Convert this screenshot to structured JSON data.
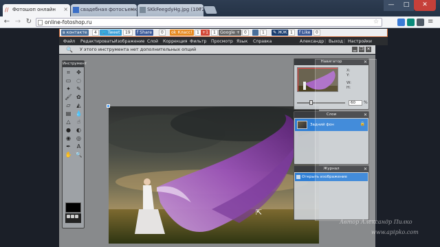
{
  "browser": {
    "tabs": [
      {
        "title": "Фотошоп онлайн",
        "favicon_color": "#c0392b",
        "active": true
      },
      {
        "title": "свадебная фотосъемка 2...",
        "favicon_color": "#3b6fc7",
        "active": false
      },
      {
        "title": "SKkFeegdyHg.jpg (1072×7...",
        "favicon_color": "#7a8a99",
        "active": false
      }
    ],
    "url": "online-fotoshop.ru",
    "controls": {
      "minimize": "—",
      "maximize": "□",
      "close": "✕"
    }
  },
  "social": {
    "items": [
      {
        "label": "контакте",
        "count": "4",
        "color": "#4a6f9a"
      },
      {
        "label": "Tweet",
        "count": "19",
        "color": "#3aa0d8"
      },
      {
        "label": "Share",
        "count": "0",
        "color": "#3b5998"
      },
      {
        "label": "Класс!",
        "count": "1",
        "color": "#e78b22"
      },
      {
        "label": "+1",
        "count": "1",
        "color": "#d34836"
      },
      {
        "label": "Google +",
        "count": "0",
        "color": "#666666"
      },
      {
        "label": "",
        "count": "1",
        "color": "#4a6f9a"
      },
      {
        "label": "ЖЖ",
        "count": "1",
        "color": "#1a3d6f"
      },
      {
        "label": "Like",
        "count": "0",
        "color": "#3b5998"
      }
    ]
  },
  "menu": {
    "items": [
      "Файл",
      "Редактировать",
      "Изображение",
      "Слой",
      "Коррекция",
      "Фильтр",
      "Просмотр",
      "Язык",
      "Справка"
    ],
    "user": "Александр",
    "logout": "Выход",
    "settings": "Настройки"
  },
  "optionsbar": {
    "text": "У этого инструмента нет дополнительных опций"
  },
  "tools": {
    "title": "Инструмент",
    "icons": [
      "crop-icon",
      "move-icon",
      "marquee-icon",
      "lasso-icon",
      "wand-icon",
      "pencil-icon",
      "brush-icon",
      "clone-icon",
      "eraser-icon",
      "bucket-icon",
      "gradient-icon",
      "blur-icon",
      "sharpen-icon",
      "smudge-icon",
      "dodge-icon",
      "burn-icon",
      "sponge-icon",
      "redeye-icon",
      "eyedropper-icon",
      "text-icon",
      "hand-icon",
      "zoom-icon"
    ],
    "glyphs": [
      "⌗",
      "✥",
      "▭",
      "◌",
      "✦",
      "✎",
      "🖌",
      "✿",
      "▱",
      "◭",
      "▤",
      "💧",
      "△",
      "☝",
      "●",
      "◐",
      "◉",
      "◎",
      "✒",
      "A",
      "✋",
      "🔍"
    ]
  },
  "navigator": {
    "title": "Навигатор",
    "x": "X:",
    "y": "Y:",
    "w": "W:",
    "h": "H:",
    "zoom": "60"
  },
  "layers": {
    "title": "Слои",
    "items": [
      {
        "name": "Задний фон"
      }
    ]
  },
  "journal": {
    "title": "Журнал",
    "items": [
      {
        "name": "Открыть изображение"
      }
    ]
  },
  "watermark": {
    "author": "Автор Александр Пилко",
    "site": "www.apipko.com"
  },
  "colors": {
    "accent": "#2e7fd6",
    "menubar": "#2b2d30",
    "workspace": "#888a8c",
    "panel_title": "#3a3c3f"
  }
}
